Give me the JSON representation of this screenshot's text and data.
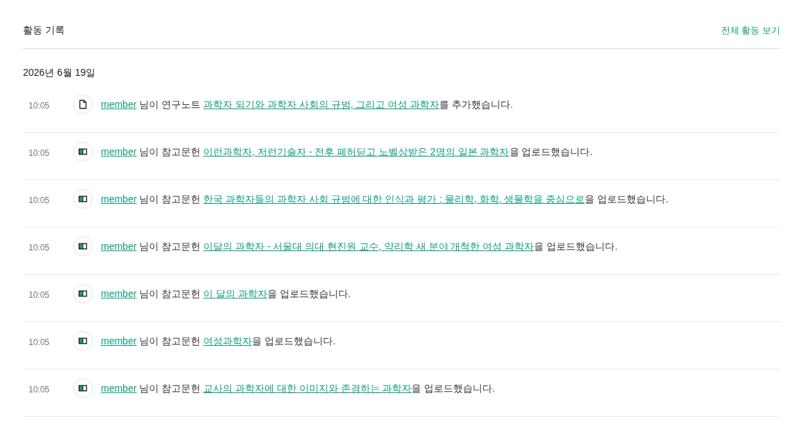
{
  "header": {
    "title": "활동 기록",
    "view_all": "전체 활동 보기"
  },
  "date": "2026년 6월 19일",
  "entries": [
    {
      "time": "10:05",
      "kind": "note",
      "user": "member",
      "action": "님이 연구노트",
      "title": "과학자 되기와 과학자 사회의 규범, 그리고 여성 과학자",
      "suffix": "를 추가했습니다."
    },
    {
      "time": "10:05",
      "kind": "reference",
      "user": "member",
      "action": "님이 참고문헌",
      "title": "이런과학자, 저런기술자 - 전후 폐허딛고 노벨상받은 2명의 일본 과학자",
      "suffix": "을 업로드했습니다."
    },
    {
      "time": "10:05",
      "kind": "reference",
      "user": "member",
      "action": "님이 참고문헌",
      "title": "한국 과학자들의 과학자 사회 규범에 대한 인식과 평가 : 물리학, 화학, 생물학을 중심으로",
      "suffix": "을 업로드했습니다."
    },
    {
      "time": "10:05",
      "kind": "reference",
      "user": "member",
      "action": "님이 참고문헌",
      "title": "이달의 과학자 - 서울대 의대 현진원 교수, 약리학 새 분야 개척한 여성 과학자",
      "suffix": "을 업로드했습니다."
    },
    {
      "time": "10:05",
      "kind": "reference",
      "user": "member",
      "action": "님이 참고문헌",
      "title": "이 달의 과학자",
      "suffix": "을 업로드했습니다."
    },
    {
      "time": "10:05",
      "kind": "reference",
      "user": "member",
      "action": "님이 참고문헌",
      "title": "여성과학자",
      "suffix": "을 업로드했습니다."
    },
    {
      "time": "10:05",
      "kind": "reference",
      "user": "member",
      "action": "님이 참고문헌",
      "title": "교사의 과학자에 대한 이미지와 존경하는 과학자",
      "suffix": "을 업로드했습니다."
    }
  ]
}
